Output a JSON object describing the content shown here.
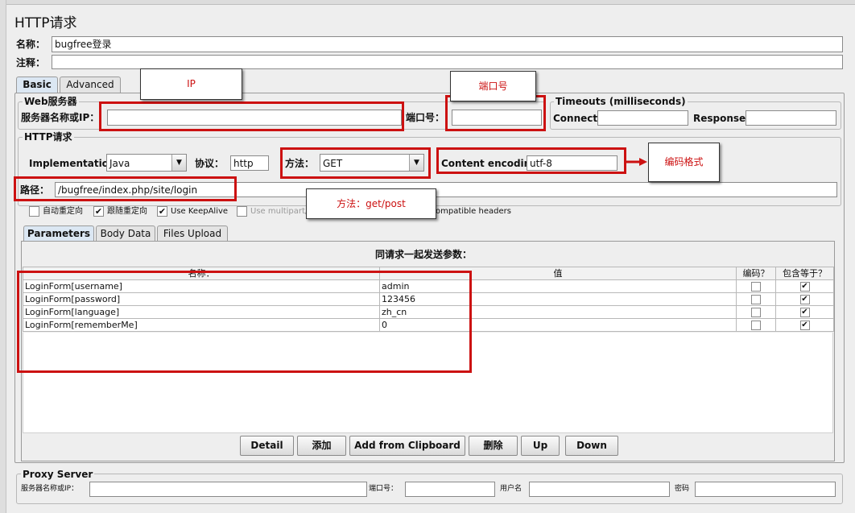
{
  "title": "HTTP请求",
  "name_label": "名称：",
  "name_value": "bugfree登录",
  "comment_label": "注释：",
  "tabs": [
    "Basic",
    "Advanced"
  ],
  "web_server": {
    "group_title": "Web服务器",
    "server_label": "服务器名称或IP：",
    "server_value": "",
    "port_label": "端口号：",
    "port_value": ""
  },
  "timeouts": {
    "group_title": "Timeouts (milliseconds)",
    "connect_label": "Connect:",
    "connect_value": "",
    "response_label": "Response:",
    "response_value": ""
  },
  "http_request": {
    "group_title": "HTTP请求",
    "implementation_label": "Implementation:",
    "implementation_value": "Java",
    "protocol_label": "协议：",
    "protocol_value": "http",
    "method_label": "方法：",
    "method_value": "GET",
    "encoding_label": "Content encoding:",
    "encoding_value": "utf-8",
    "path_label": "路径：",
    "path_value": "/bugfree/index.php/site/login"
  },
  "options": [
    {
      "label": "自动重定向",
      "checked": false
    },
    {
      "label": "跟随重定向",
      "checked": true
    },
    {
      "label": "Use KeepAlive",
      "checked": true
    },
    {
      "label": "Use multipart/f",
      "checked": false
    },
    {
      "label": "ompatible headers",
      "checked": false
    }
  ],
  "subtabs": [
    "Parameters",
    "Body Data",
    "Files Upload"
  ],
  "params_caption": "同请求一起发送参数：",
  "columns": [
    "名称：",
    "值",
    "编码？",
    "包含等于？"
  ],
  "rows": [
    {
      "name": "LoginForm[username]",
      "value": "admin",
      "encode": false,
      "include_equals": true
    },
    {
      "name": "LoginForm[password]",
      "value": "123456",
      "encode": false,
      "include_equals": true
    },
    {
      "name": "LoginForm[language]",
      "value": "zh_cn",
      "encode": false,
      "include_equals": true
    },
    {
      "name": "LoginForm[rememberMe]",
      "value": "0",
      "encode": false,
      "include_equals": true
    }
  ],
  "buttons": [
    "Detail",
    "添加",
    "Add from Clipboard",
    "删除",
    "Up",
    "Down"
  ],
  "proxy": {
    "group_title": "Proxy Server",
    "server_label": "服务器名称或IP：",
    "port_label": "端口号：",
    "user_label": "用户名",
    "password_label": "密码"
  },
  "annotations": {
    "ip": "IP",
    "port": "端口号",
    "encoding": "编码格式",
    "method": "方法：get/post"
  },
  "colors": {
    "annotation_red": "#cc1111",
    "active_tab": "#dbe7f3",
    "panel_bg": "#eeeeee"
  }
}
